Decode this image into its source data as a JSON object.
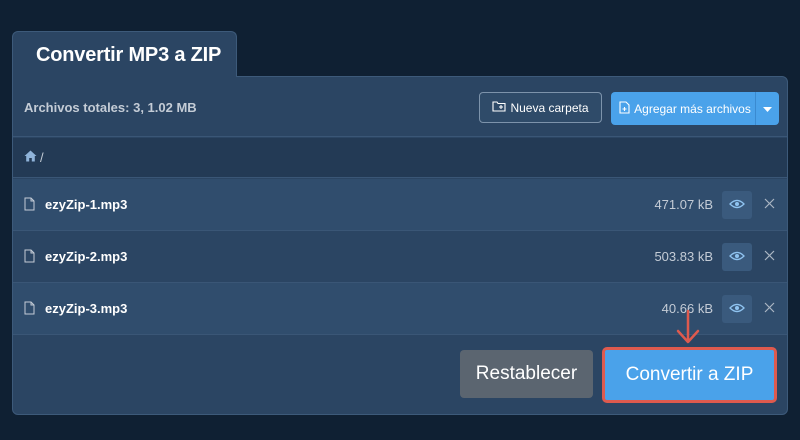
{
  "tab": {
    "title": "Convertir MP3 a ZIP"
  },
  "toolbar": {
    "total_label": "Archivos totales: 3, 1.02 MB",
    "new_folder_label": "Nueva carpeta",
    "add_files_label": "Agregar más archivos"
  },
  "breadcrumb": {
    "path": "/"
  },
  "files": [
    {
      "name": "ezyZip-1.mp3",
      "size": "471.07 kB"
    },
    {
      "name": "ezyZip-2.mp3",
      "size": "503.83 kB"
    },
    {
      "name": "ezyZip-3.mp3",
      "size": "40.66 kB"
    }
  ],
  "actions": {
    "reset_label": "Restablecer",
    "convert_label": "Convertir a ZIP"
  },
  "icons": {
    "home": "home-icon",
    "file": "file-icon",
    "eye": "eye-icon",
    "close": "close-icon",
    "folder_plus": "folder-plus-icon",
    "file_plus": "file-plus-icon",
    "caret": "caret-down-icon",
    "arrow": "arrow-down-icon"
  },
  "colors": {
    "background": "#0f2033",
    "panel": "#2b4563",
    "primary": "#4aa2ea",
    "secondary": "#5b6570",
    "highlight": "#de5a4e"
  }
}
